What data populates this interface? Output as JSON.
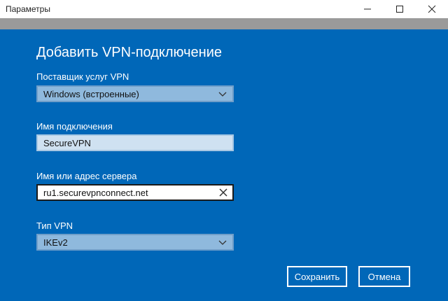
{
  "window": {
    "title": "Параметры",
    "minimize_icon": "minimize-icon",
    "maximize_icon": "maximize-icon",
    "close_icon": "close-icon"
  },
  "dialog": {
    "heading": "Добавить VPN-подключение",
    "provider": {
      "label": "Поставщик услуг VPN",
      "value": "Windows (встроенные)"
    },
    "connection_name": {
      "label": "Имя подключения",
      "value": "SecureVPN"
    },
    "server": {
      "label": "Имя или адрес сервера",
      "value": "ru1.securevpnconnect.net"
    },
    "vpn_type": {
      "label": "Тип VPN",
      "value": "IKEv2"
    },
    "save_label": "Сохранить",
    "cancel_label": "Отмена"
  },
  "colors": {
    "accent": "#0067b8",
    "select_fill": "#8fb9dd",
    "textbox_fill": "#cfe1f1"
  }
}
